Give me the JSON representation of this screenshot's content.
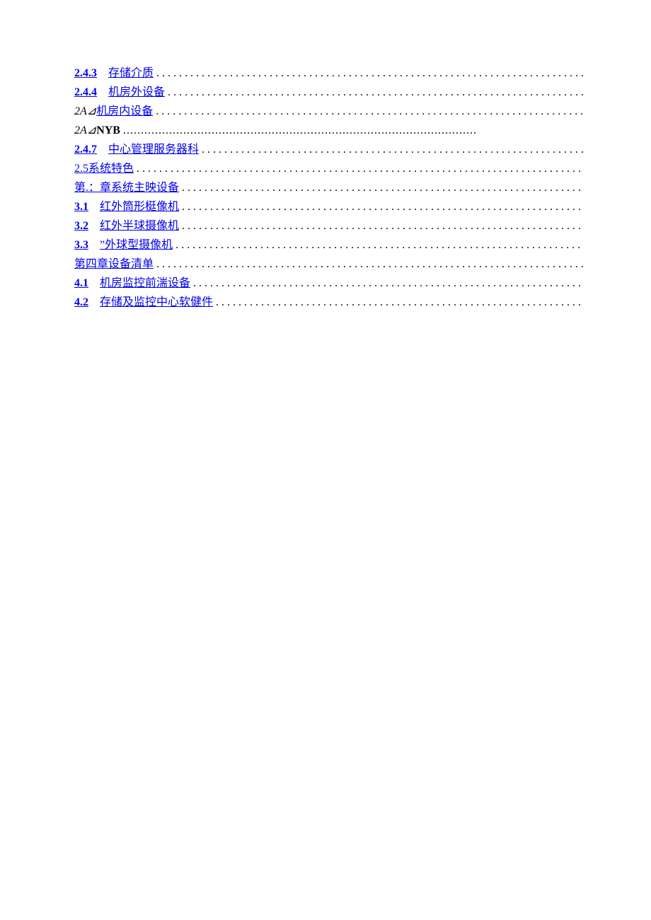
{
  "toc": [
    {
      "number": "2.4.3",
      "numberClass": "toc-number",
      "gap": "　",
      "title": "存储介质",
      "titleClass": "toc-title",
      "dotsClass": "toc-dots"
    },
    {
      "number": "2.4.4",
      "numberClass": "toc-number",
      "gap": "　",
      "title": "机房外设备",
      "titleClass": "toc-title",
      "dotsClass": "toc-dots"
    },
    {
      "number": "2A⊿",
      "numberClass": "toc-number nolink",
      "gap": "",
      "title": "机房内设备",
      "titleClass": "toc-title",
      "dotsClass": "toc-dots"
    },
    {
      "number": "2A⊿",
      "numberClass": "toc-number nolink",
      "gap": "",
      "title": "NYB",
      "titleClass": "toc-title nolink bold",
      "dotsClass": "toc-dots dense"
    },
    {
      "number": "2.4.7",
      "numberClass": "toc-number",
      "gap": "　",
      "title": "中心管理服务器科",
      "titleClass": "toc-title",
      "dotsClass": "toc-dots"
    },
    {
      "number": "2.5",
      "numberClass": "toc-number plain",
      "gap": "",
      "title": "系统特色",
      "titleClass": "toc-title",
      "dotsClass": "toc-dots"
    },
    {
      "number": "",
      "numberClass": "",
      "gap": "",
      "title": "第.：章系统主映设备",
      "titleClass": "toc-title",
      "dotsClass": "toc-dots"
    },
    {
      "number": "3.1",
      "numberClass": "toc-number",
      "gap": "　",
      "title": "红外筒形梃像机",
      "titleClass": "toc-title",
      "dotsClass": "toc-dots"
    },
    {
      "number": "3.2",
      "numberClass": "toc-number",
      "gap": "　",
      "title": "红外半球摄像机",
      "titleClass": "toc-title",
      "dotsClass": "toc-dots"
    },
    {
      "number": "3.3",
      "numberClass": "toc-number",
      "gap": "　",
      "title": "”外球型摄像机",
      "titleClass": "toc-title",
      "dotsClass": "toc-dots"
    },
    {
      "number": "",
      "numberClass": "",
      "gap": "",
      "title": "第四章设备清单",
      "titleClass": "toc-title",
      "dotsClass": "toc-dots"
    },
    {
      "number": "4.1",
      "numberClass": "toc-number",
      "gap": "　",
      "title": "机房监控前湍设备",
      "titleClass": "toc-title",
      "dotsClass": "toc-dots"
    },
    {
      "number": "4.2",
      "numberClass": "toc-number",
      "gap": "　",
      "title": "存储及监控中心软健件",
      "titleClass": "toc-title",
      "dotsClass": "toc-dots"
    }
  ],
  "dotString": "...................................................................................................."
}
